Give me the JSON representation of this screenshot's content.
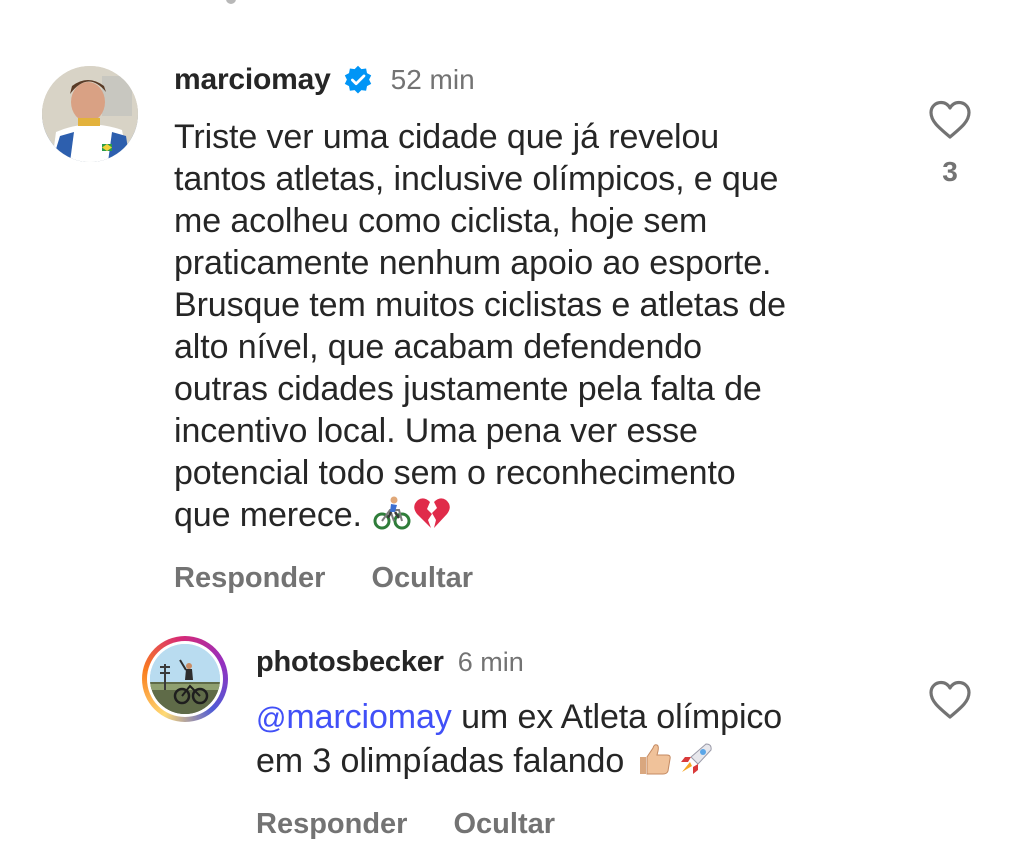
{
  "comment": {
    "username": "marciomay",
    "verified": true,
    "timestamp": "52 min",
    "text": "Triste ver uma cidade que já revelou\ntantos atletas, inclusive olímpicos, e que\nme acolheu como ciclista, hoje sem\npraticamente nenhum apoio ao esporte.\nBrusque tem muitos ciclistas e atletas de\nalto nível, que acabam defendendo\noutras cidades justamente pela falta de\nincentivo local. Uma pena ver esse\npotencial todo sem o reconhecimento\nque merece.",
    "emojis": [
      "cyclist-emoji",
      "broken-heart-emoji"
    ],
    "like_count": "3",
    "actions": {
      "reply": "Responder",
      "hide": "Ocultar"
    }
  },
  "reply": {
    "username": "photosbecker",
    "timestamp": "6 min",
    "mention": "marciomay",
    "mention_prefix_icon": "threads-icon",
    "text_line1": " um ex Atleta olímpico",
    "text_line2": "em 3 olimpíadas falando",
    "emojis": [
      "thumbs-up-emoji",
      "rocket-emoji"
    ],
    "actions": {
      "reply": "Responder",
      "hide": "Ocultar"
    }
  },
  "colors": {
    "text": "#262626",
    "secondary": "#737373",
    "mention": "#4150f7",
    "verified": "#0095f6"
  }
}
